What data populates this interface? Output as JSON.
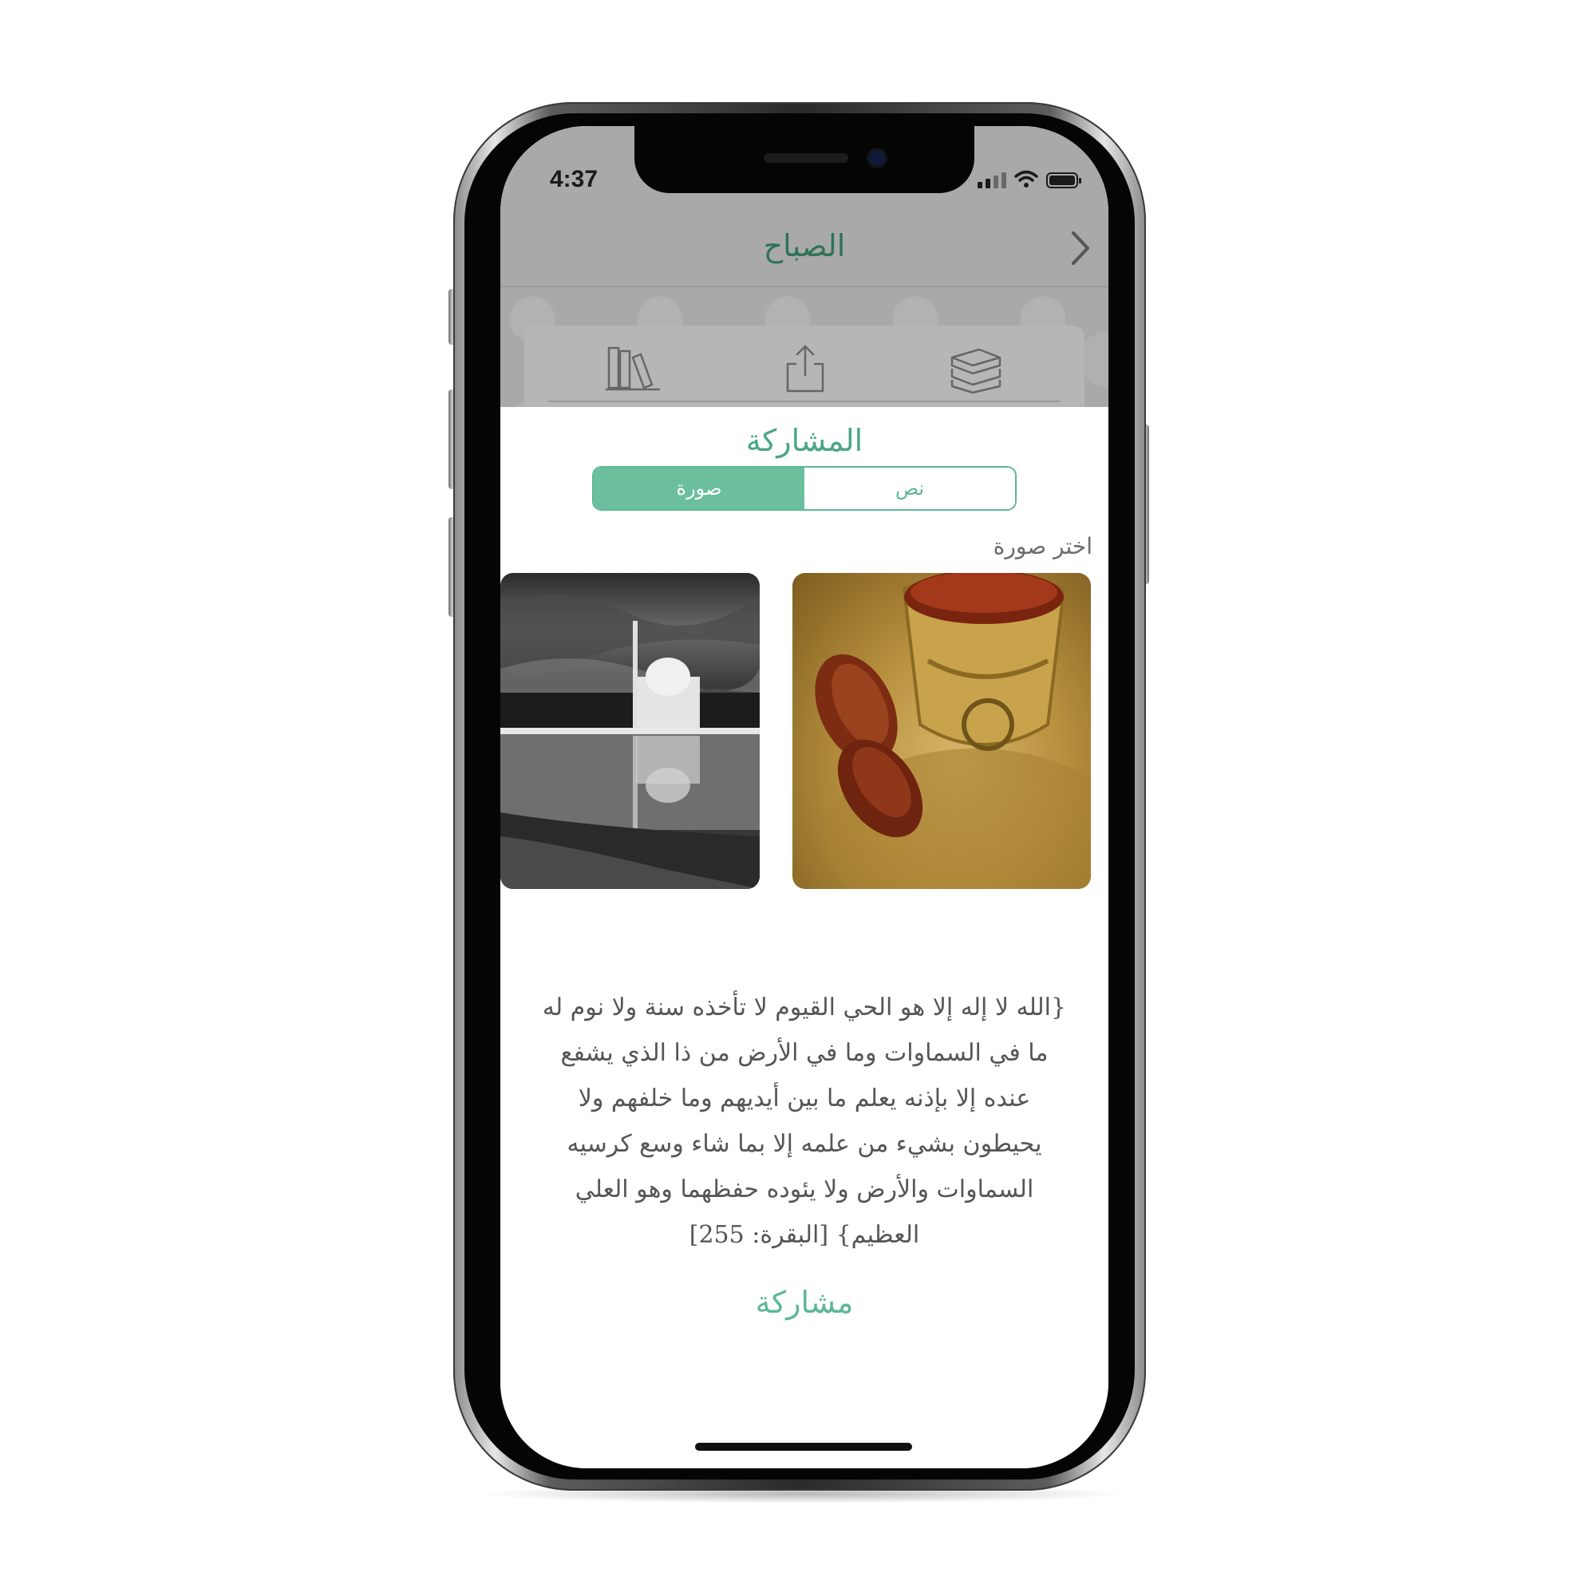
{
  "status_bar": {
    "time": "4:37"
  },
  "nav": {
    "title": "الصباح"
  },
  "toolbar": {
    "icons": [
      "books-icon",
      "share-icon",
      "book-stack-icon"
    ]
  },
  "share_sheet": {
    "title": "المشاركة",
    "segments": {
      "image_label": "صورة",
      "text_label": "نص",
      "selected": "صورة"
    },
    "choose_image_label": "اختر صورة",
    "images": [
      "dates-and-tea-image",
      "mosque-reflection-image"
    ],
    "verse_lines": [
      "{الله لا إله إلا هو الحي القيوم لا تأخذه سنة ولا نوم له",
      "ما في السماوات وما في الأرض من ذا الذي يشفع",
      "عنده إلا بإذنه يعلم ما بين أيديهم وما خلفهم ولا",
      "يحيطون بشيء من علمه إلا بما شاء وسع كرسيه",
      "السماوات والأرض ولا يئوده حفظهما وهو العلي",
      "العظيم} [البقرة: 255]"
    ],
    "share_button_label": "مشاركة"
  },
  "colors": {
    "accent": "#5cb893",
    "segment_active": "#6cbf9d",
    "nav_title": "#2e7358",
    "verse_text": "#555555"
  }
}
